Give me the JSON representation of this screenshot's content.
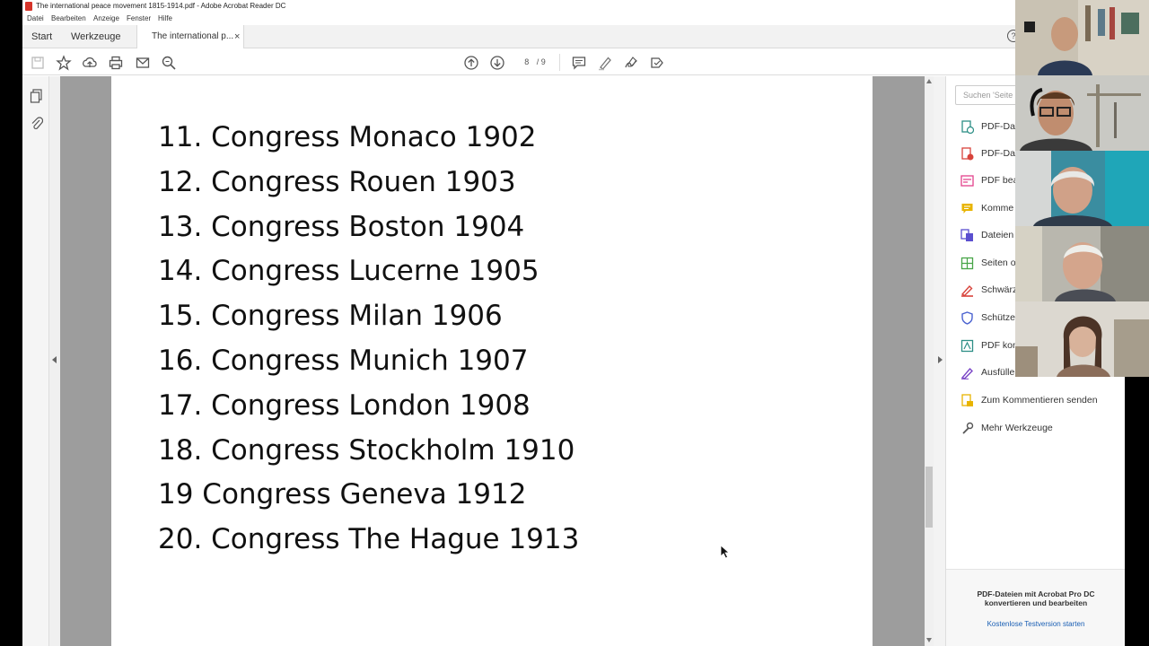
{
  "window": {
    "title": "The international peace movement 1815-1914.pdf - Adobe Acrobat Reader DC",
    "menu": [
      "Datei",
      "Bearbeiten",
      "Anzeige",
      "Fenster",
      "Hilfe"
    ]
  },
  "tabs": {
    "start": "Start",
    "tools": "Werkzeuge",
    "document": "The international p...",
    "close": "×",
    "help": "?"
  },
  "toolbar": {
    "page_current": "8",
    "page_total": "/ 9"
  },
  "document": {
    "lines": [
      "11. Congress Monaco 1902",
      "12. Congress Rouen 1903",
      "13. Congress Boston 1904",
      "14. Congress Lucerne 1905",
      "15. Congress Milan 1906",
      "16. Congress Munich 1907",
      "17. Congress London 1908",
      "18. Congress Stockholm 1910",
      "19 Congress Geneva 1912",
      "20. Congress The Hague 1913"
    ]
  },
  "tools_pane": {
    "search_placeholder": "Suchen 'Seite e",
    "items": [
      {
        "label": "PDF-Dat",
        "icon": "pdf-export-icon",
        "color": "#2d8f86"
      },
      {
        "label": "PDF-Dat",
        "icon": "pdf-create-icon",
        "color": "#d8433b"
      },
      {
        "label": "PDF bea",
        "icon": "pdf-edit-icon",
        "color": "#e3428b"
      },
      {
        "label": "Komme",
        "icon": "comment-icon",
        "color": "#e8b400"
      },
      {
        "label": "Dateien",
        "icon": "combine-files-icon",
        "color": "#5b4fcf"
      },
      {
        "label": "Seiten o",
        "icon": "organize-pages-icon",
        "color": "#48a548"
      },
      {
        "label": "Schwärz",
        "icon": "redact-icon",
        "color": "#d8433b"
      },
      {
        "label": "Schütze",
        "icon": "protect-icon",
        "color": "#4a62d0"
      },
      {
        "label": "PDF kon",
        "icon": "optimize-pdf-icon",
        "color": "#2d8f86"
      },
      {
        "label": "Ausfülle",
        "icon": "fill-sign-icon",
        "color": "#7b46c7"
      },
      {
        "label": "Zum Kommentieren senden",
        "icon": "send-comment-icon",
        "color": "#e8b400"
      },
      {
        "label": "Mehr Werkzeuge",
        "icon": "more-tools-icon",
        "color": "#555555"
      }
    ],
    "promo_title": "PDF-Dateien mit Acrobat Pro DC konvertieren und bearbeiten",
    "promo_link": "Kostenlose Testversion starten"
  },
  "colors": {
    "doc_background": "#9d9d9d",
    "accent_link": "#1a5fb4"
  }
}
